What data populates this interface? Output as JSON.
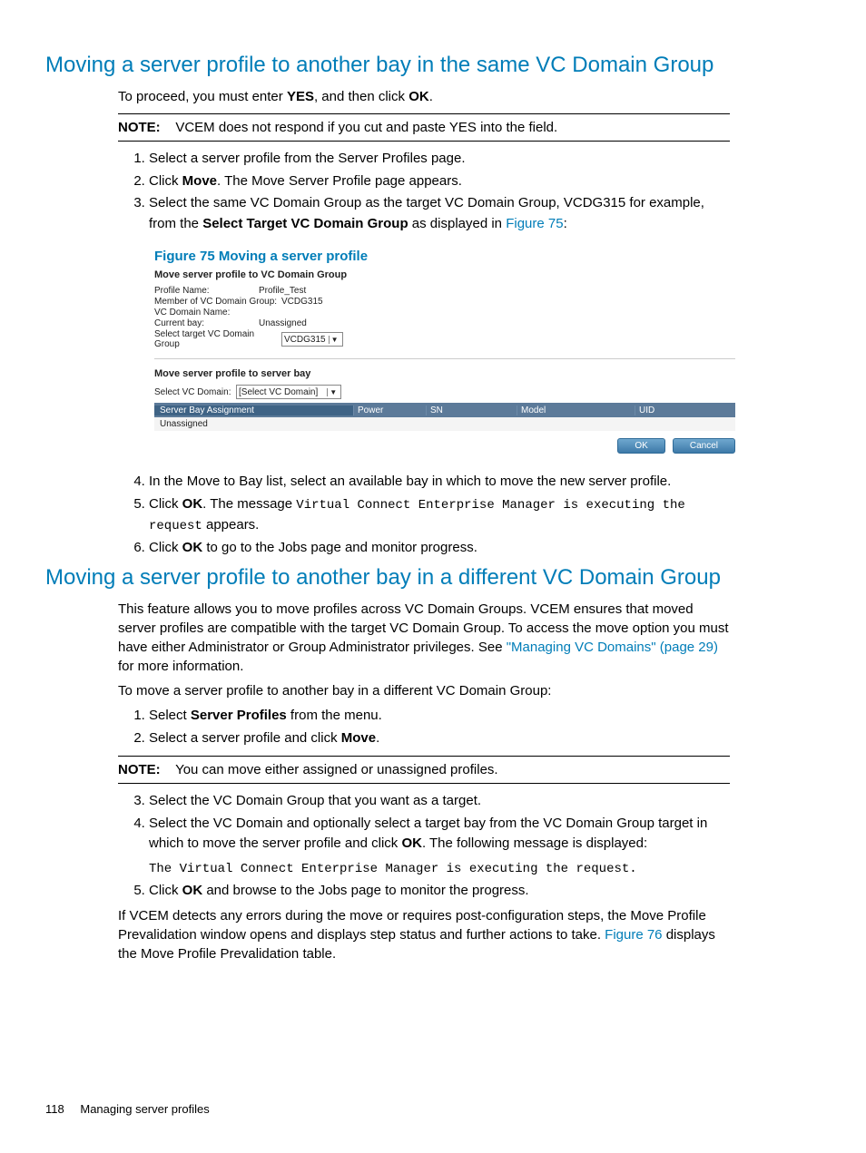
{
  "section1": {
    "title": "Moving a server profile to another bay in the same VC Domain Group",
    "intro_before": "To proceed, you must enter ",
    "intro_yes": "YES",
    "intro_mid": ", and then click ",
    "intro_ok": "OK",
    "intro_after": ".",
    "note_label": "NOTE:",
    "note_text": "VCEM does not respond if you cut and paste YES into the field.",
    "list1": {
      "i1": "Select a server profile from the Server Profiles page.",
      "i2_a": "Click ",
      "i2_b": "Move",
      "i2_c": ". The Move Server Profile page appears.",
      "i3_a": "Select the same VC Domain Group as the target VC Domain Group, VCDG315 for example, from the ",
      "i3_b": "Select Target VC Domain Group",
      "i3_c": " as displayed in ",
      "i3_link": "Figure 75",
      "i3_d": ":"
    },
    "figure_caption": "Figure 75 Moving a server profile",
    "figure": {
      "heading1": "Move server profile to VC Domain Group",
      "row1_label": "Profile Name:",
      "row1_val": "Profile_Test",
      "row2_label": "Member of VC Domain Group:",
      "row2_val": "VCDG315",
      "row3_label": "VC Domain Name:",
      "row3_val": "",
      "row4_label": "Current bay:",
      "row4_val": "Unassigned",
      "row5_label": "Select target VC Domain Group",
      "row5_select": "VCDG315",
      "heading2": "Move server profile to server bay",
      "row6_label": "Select VC Domain:",
      "row6_select": "[Select VC Domain]",
      "col_bay": "Server Bay Assignment",
      "col_power": "Power",
      "col_sn": "SN",
      "col_model": "Model",
      "col_uid": "UID",
      "table_row1": "Unassigned",
      "btn_ok": "OK",
      "btn_cancel": "Cancel"
    },
    "list2": {
      "i4": "In the Move to Bay list, select an available bay in which to move the new server profile.",
      "i5_a": "Click ",
      "i5_b": "OK",
      "i5_c": ". The message ",
      "i5_code": "Virtual Connect Enterprise Manager is executing the request",
      "i5_d": " appears.",
      "i6_a": "Click ",
      "i6_b": "OK",
      "i6_c": " to go to the Jobs page and monitor progress."
    }
  },
  "section2": {
    "title": "Moving a server profile to another bay in a different VC Domain Group",
    "p1_a": "This feature allows you to move profiles across VC Domain Groups. VCEM ensures that moved server profiles are compatible with the target VC Domain Group. To access the move option you must have either Administrator or Group Administrator privileges. See ",
    "p1_link": "\"Managing VC Domains\" (page 29)",
    "p1_b": " for more information.",
    "p2": "To move a server profile to another bay in a different VC Domain Group:",
    "list1": {
      "i1_a": "Select ",
      "i1_b": "Server Profiles",
      "i1_c": " from the menu.",
      "i2_a": "Select a server profile and click ",
      "i2_b": "Move",
      "i2_c": "."
    },
    "note_label": "NOTE:",
    "note_text": "You can move either assigned or unassigned profiles.",
    "list2": {
      "i3": "Select the VC Domain Group that you want as a target.",
      "i4_a": "Select the VC Domain and optionally select a target bay from the VC Domain Group target in which to move the server profile and click ",
      "i4_b": "OK",
      "i4_c": ". The following message is displayed:",
      "i4_code": "The Virtual Connect Enterprise Manager is executing the request.",
      "i5_a": "Click ",
      "i5_b": "OK",
      "i5_c": " and browse to the Jobs page to monitor the progress."
    },
    "p3_a": "If VCEM detects any errors during the move or requires post-configuration steps, the Move Profile Prevalidation window opens and displays step status and further actions to take. ",
    "p3_link": "Figure 76",
    "p3_b": " displays the Move Profile Prevalidation table."
  },
  "footer": {
    "page": "118",
    "label": "Managing server profiles"
  }
}
